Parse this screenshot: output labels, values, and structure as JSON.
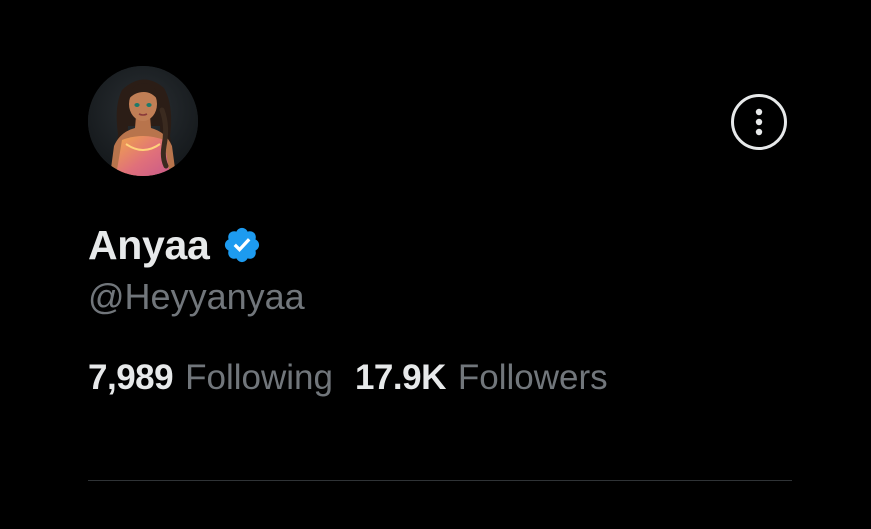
{
  "profile": {
    "display_name": "Anyaa",
    "handle": "@Heyyanyaa",
    "verified": true,
    "avatar": "avatar-illustration-woman",
    "following_count": "7,989",
    "following_label": "Following",
    "followers_count": "17.9K",
    "followers_label": "Followers"
  },
  "icons": {
    "more": "more-options-icon",
    "verified": "verified-badge-icon"
  },
  "colors": {
    "background": "#000000",
    "primary_text": "#e7e9ea",
    "secondary_text": "#71767b",
    "verified_blue": "#1d9bf0",
    "divider": "#2f3336"
  }
}
